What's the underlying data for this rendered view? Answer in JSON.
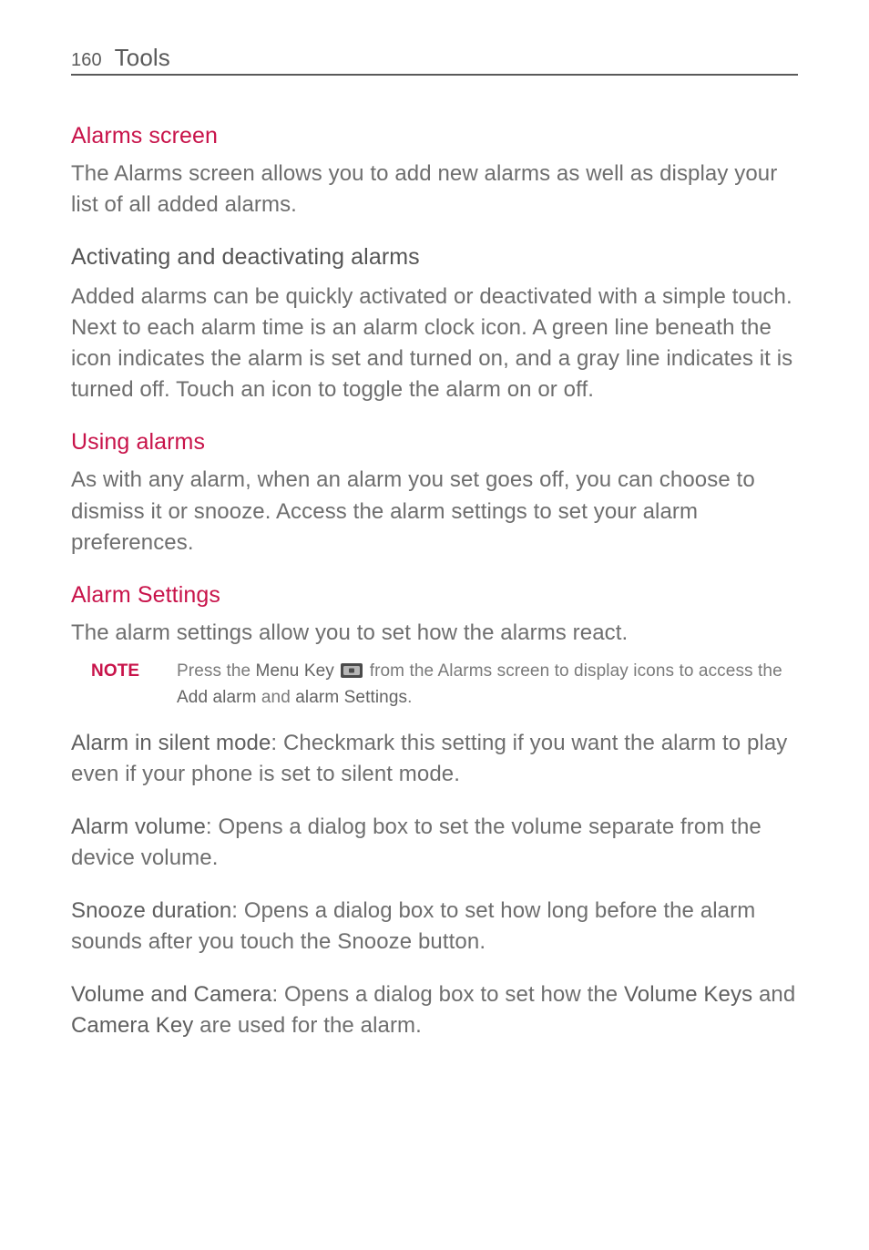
{
  "header": {
    "page_number": "160",
    "chapter": "Tools"
  },
  "sections": {
    "alarms_screen": {
      "heading": "Alarms screen",
      "body": "The Alarms screen allows you to add new alarms as well as display your list of all added alarms."
    },
    "activating": {
      "heading": "Activating and deactivating alarms",
      "body": "Added alarms can be quickly activated or deactivated with a simple touch. Next to each alarm time is an alarm clock icon. A green line beneath the icon indicates the alarm is set and turned on, and a gray line indicates it is turned off. Touch an icon to toggle the alarm on or off."
    },
    "using_alarms": {
      "heading": "Using alarms",
      "body": "As with any alarm, when an alarm you set goes off, you can choose to dismiss it or snooze. Access the alarm settings to set your alarm preferences."
    },
    "alarm_settings": {
      "heading": "Alarm Settings",
      "body": "The alarm settings allow you to set how the alarms react."
    }
  },
  "note": {
    "label": "NOTE",
    "prefix": "Press the ",
    "menu_key": "Menu Key",
    "mid1": " from the Alarms screen to display icons to access the ",
    "add_alarm": "Add alarm",
    "mid2": " and ",
    "alarm_settings": "alarm Settings",
    "suffix": "."
  },
  "definitions": {
    "silent": {
      "term": "Alarm in silent mode",
      "desc": ": Checkmark this setting if you want the alarm to play even if your phone is set to silent mode."
    },
    "volume": {
      "term": "Alarm volume",
      "desc": ": Opens a dialog box to set the volume separate from the device volume."
    },
    "snooze": {
      "term": "Snooze duration",
      "desc": ": Opens a dialog box to set how long before the alarm sounds after you touch the Snooze button."
    },
    "vol_cam": {
      "term": "Volume and Camera",
      "mid1": ": Opens a dialog box to set how the ",
      "vk": "Volume Keys",
      "mid2": " and ",
      "ck": "Camera Key",
      "suffix": " are used for the alarm."
    }
  }
}
